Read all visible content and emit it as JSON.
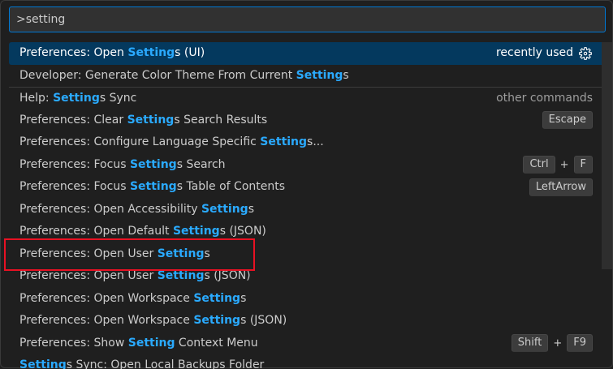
{
  "search": {
    "value": ">setting"
  },
  "items": [
    {
      "pre": "Preferences: Open ",
      "hl": "Setting",
      "post": "s (UI)",
      "right_label": "recently used"
    },
    {
      "pre": "Developer: Generate Color Theme From Current ",
      "hl": "Setting",
      "post": "s"
    },
    {
      "pre": "Help: ",
      "hl": "Setting",
      "post": "s Sync",
      "right_label": "other commands"
    },
    {
      "pre": "Preferences: Clear ",
      "hl": "Setting",
      "post": "s Search Results",
      "key1": "Escape"
    },
    {
      "pre": "Preferences: Configure Language Specific ",
      "hl": "Setting",
      "post": "s..."
    },
    {
      "pre": "Preferences: Focus ",
      "hl": "Setting",
      "post": "s Search",
      "key1": "Ctrl",
      "plus": "+",
      "key2": "F"
    },
    {
      "pre": "Preferences: Focus ",
      "hl": "Setting",
      "post": "s Table of Contents",
      "key1": "LeftArrow"
    },
    {
      "pre": "Preferences: Open Accessibility ",
      "hl": "Setting",
      "post": "s"
    },
    {
      "pre": "Preferences: Open Default ",
      "hl": "Setting",
      "post": "s (JSON)"
    },
    {
      "pre": "Preferences: Open User ",
      "hl": "Setting",
      "post": "s"
    },
    {
      "pre": "Preferences: Open User ",
      "hl": "Setting",
      "post": "s (JSON)"
    },
    {
      "pre": "Preferences: Open Workspace ",
      "hl": "Setting",
      "post": "s"
    },
    {
      "pre": "Preferences: Open Workspace ",
      "hl": "Setting",
      "post": "s (JSON)"
    },
    {
      "pre": "Preferences: Show ",
      "hl": "Setting",
      "post": " Context Menu",
      "key1": "Shift",
      "plus": "+",
      "key2": "F9"
    },
    {
      "pre": "",
      "hl": "Setting",
      "post": "s Sync: Open Local Backups Folder"
    }
  ],
  "colors": {
    "highlight": "#2aaaff",
    "active_bg": "#04395e",
    "annotation_box": "#e81123"
  },
  "icons": {
    "recent": "gear-icon"
  }
}
